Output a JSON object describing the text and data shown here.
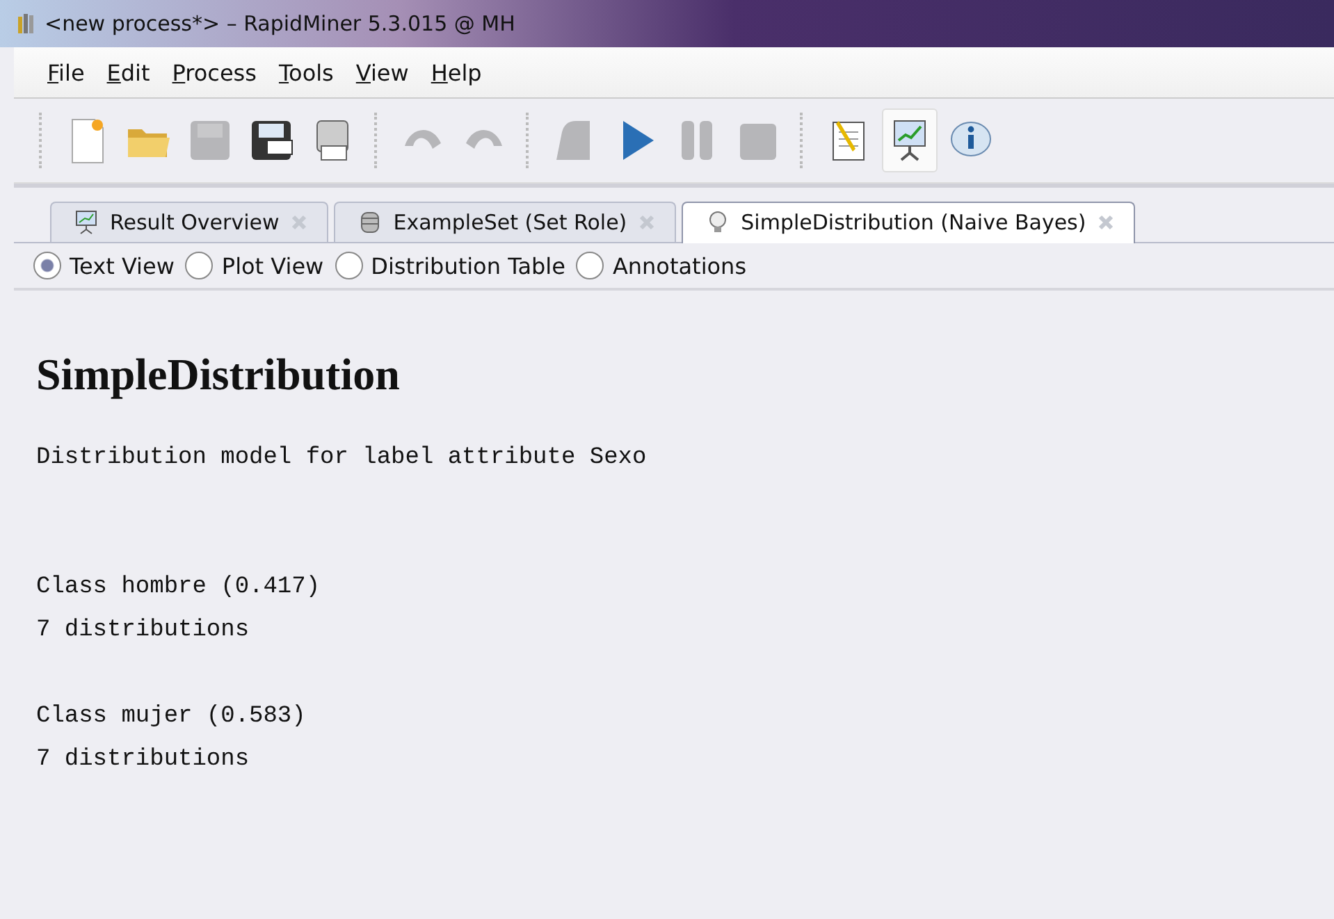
{
  "window": {
    "title": "<new process*> – RapidMiner 5.3.015 @ MH"
  },
  "menu": [
    "File",
    "Edit",
    "Process",
    "Tools",
    "View",
    "Help"
  ],
  "toolbar": [
    {
      "kind": "new",
      "disabled": false,
      "selected": false
    },
    {
      "kind": "open",
      "disabled": false,
      "selected": false
    },
    {
      "kind": "save",
      "disabled": true,
      "selected": false
    },
    {
      "kind": "save-as",
      "disabled": false,
      "selected": false
    },
    {
      "kind": "print",
      "disabled": false,
      "selected": false
    },
    {
      "kind": "sep"
    },
    {
      "kind": "undo",
      "disabled": true,
      "selected": false
    },
    {
      "kind": "redo",
      "disabled": true,
      "selected": false
    },
    {
      "kind": "sep"
    },
    {
      "kind": "validate",
      "disabled": true,
      "selected": false
    },
    {
      "kind": "run",
      "disabled": false,
      "selected": false
    },
    {
      "kind": "pause",
      "disabled": true,
      "selected": false
    },
    {
      "kind": "stop",
      "disabled": true,
      "selected": false
    },
    {
      "kind": "sep"
    },
    {
      "kind": "design",
      "disabled": false,
      "selected": false
    },
    {
      "kind": "results",
      "disabled": false,
      "selected": true
    },
    {
      "kind": "info",
      "disabled": false,
      "selected": false
    }
  ],
  "tabs": [
    {
      "label": "Result Overview",
      "selected": false
    },
    {
      "label": "ExampleSet (Set Role)",
      "selected": false
    },
    {
      "label": "SimpleDistribution (Naive Bayes)",
      "selected": true
    }
  ],
  "views": [
    {
      "label": "Text View",
      "selected": true
    },
    {
      "label": "Plot View",
      "selected": false
    },
    {
      "label": "Distribution Table",
      "selected": false
    },
    {
      "label": "Annotations",
      "selected": false
    }
  ],
  "content": {
    "heading": "SimpleDistribution",
    "paragraphs": [
      [
        "Distribution model for label attribute Sexo"
      ],
      [
        "Class hombre (0.417)",
        "7 distributions"
      ],
      [
        "Class mujer (0.583)",
        "7 distributions"
      ]
    ]
  }
}
